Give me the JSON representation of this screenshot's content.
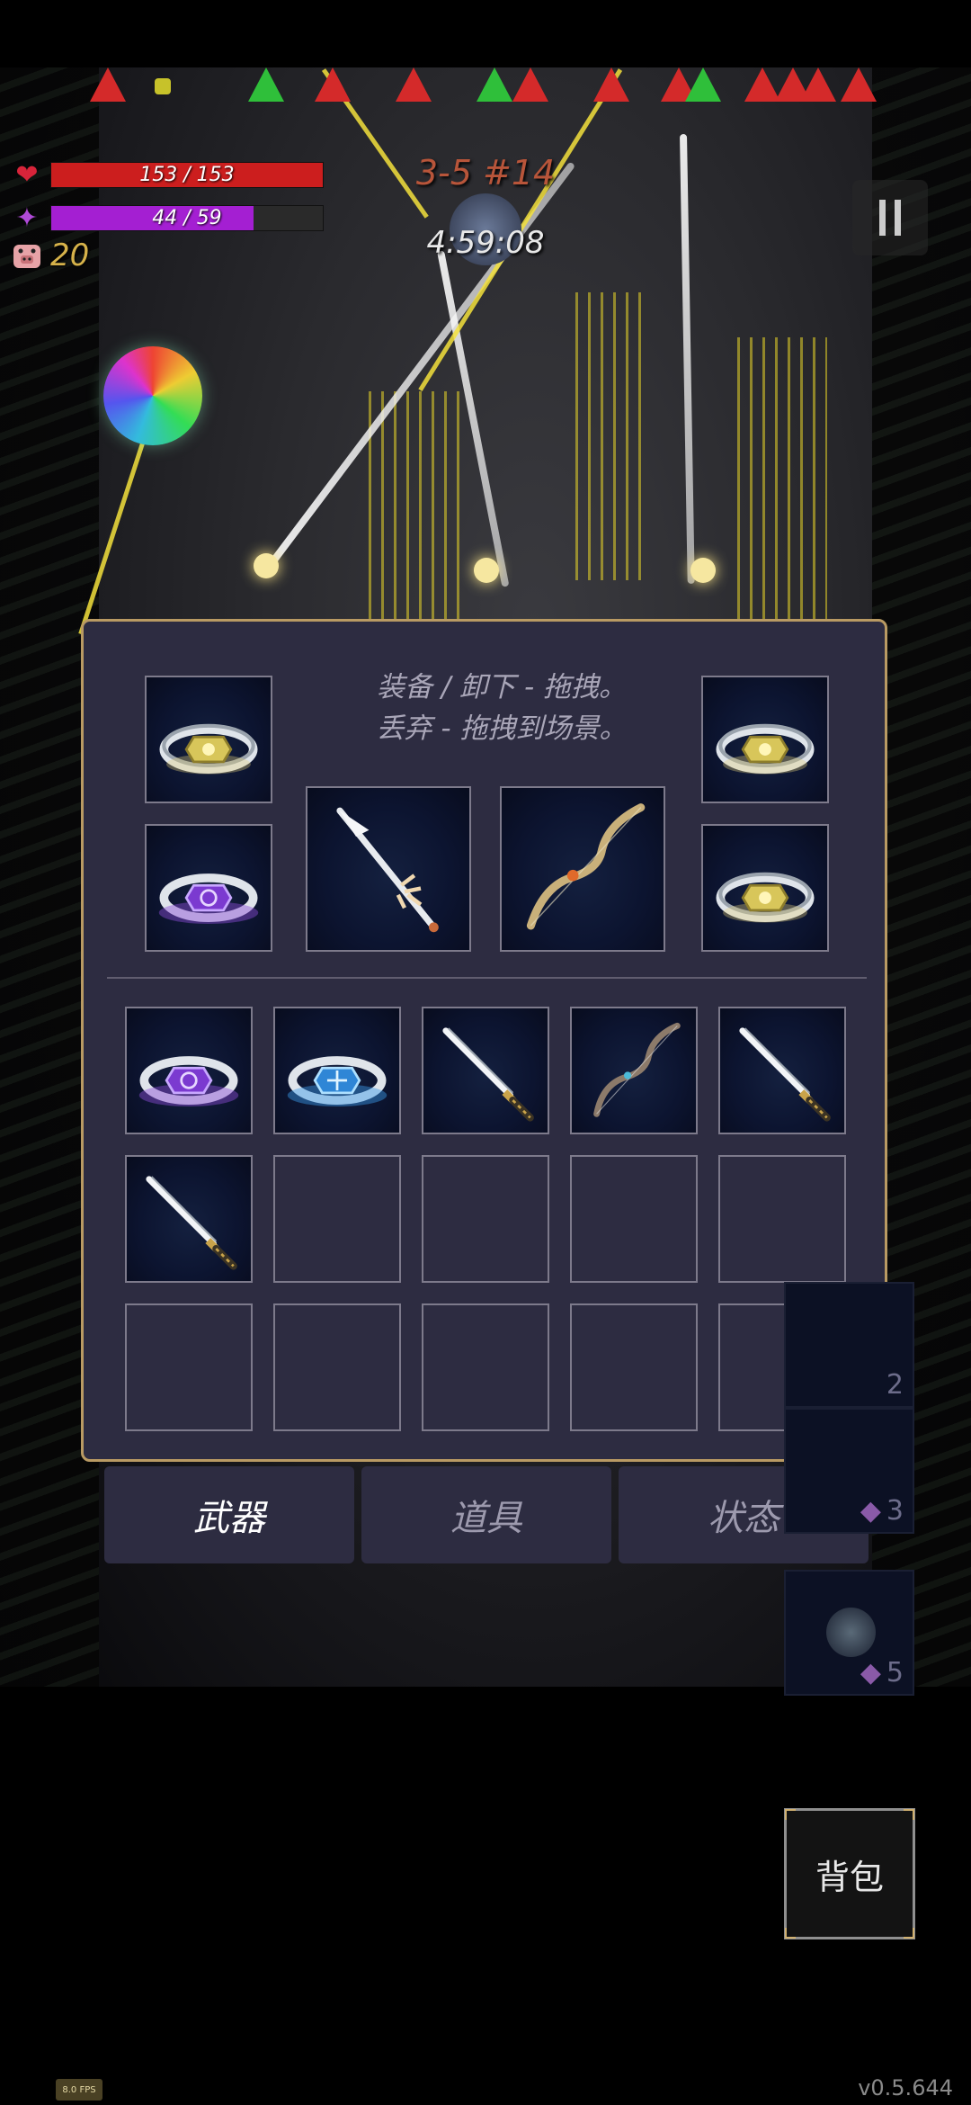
{
  "hud": {
    "hp_text": "153 / 153",
    "hp_fraction": 1.0,
    "mp_text": "44 / 59",
    "mp_fraction": 0.746,
    "gold": "20",
    "stage": "3-5 #14",
    "timer": "4:59:08",
    "colors": {
      "hp": "#cc1e1e",
      "mp": "#a41fd2",
      "gold": "#d6b24a"
    }
  },
  "inventory": {
    "hint_line1": "装备 / 卸下 - 拖拽。",
    "hint_line2": "丢弃 - 拖拽到场景。",
    "equipped": [
      {
        "slot": "ring-top-left",
        "item": "gold-ring"
      },
      {
        "slot": "ring-top-right",
        "item": "gold-ring"
      },
      {
        "slot": "ring-bottom-left",
        "item": "purple-ring"
      },
      {
        "slot": "ring-bottom-right",
        "item": "gold-ring"
      },
      {
        "slot": "weapon-1",
        "item": "spear"
      },
      {
        "slot": "weapon-2",
        "item": "bow"
      }
    ],
    "bag_items": [
      "purple-ring",
      "blue-ring",
      "katana",
      "bow",
      "katana",
      "katana",
      "",
      "",
      "",
      "",
      "",
      "",
      "",
      "",
      ""
    ]
  },
  "tabs": [
    "武器",
    "道具",
    "状态"
  ],
  "active_tab": 0,
  "side_counts": [
    "2",
    "3",
    "5"
  ],
  "bag_button": "背包",
  "fps": "8.0 FPS",
  "version": "v0.5.644"
}
